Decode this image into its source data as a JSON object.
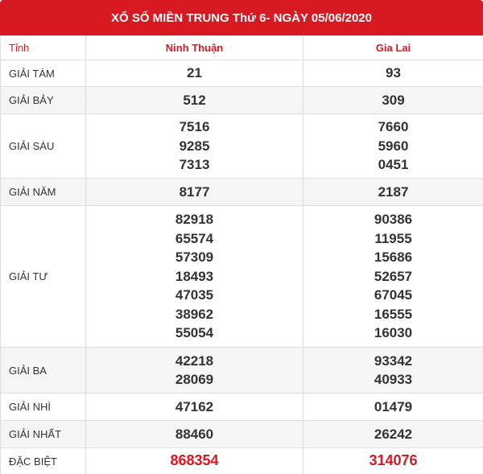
{
  "title": "XỔ SỐ MIỀN TRUNG Thứ 6- NGÀY 05/06/2020",
  "header": {
    "col_label": "Tỉnh",
    "provinces": [
      "Ninh Thuận",
      "Gia Lai"
    ]
  },
  "rows": [
    {
      "label": "GIẢI TÁM",
      "values": [
        [
          "21"
        ],
        [
          "93"
        ]
      ]
    },
    {
      "label": "GIẢI BẢY",
      "values": [
        [
          "512"
        ],
        [
          "309"
        ]
      ]
    },
    {
      "label": "GIẢI SÁU",
      "values": [
        [
          "7516",
          "9285",
          "7313"
        ],
        [
          "7660",
          "5960",
          "0451"
        ]
      ]
    },
    {
      "label": "GIẢI NĂM",
      "values": [
        [
          "8177"
        ],
        [
          "2187"
        ]
      ]
    },
    {
      "label": "GIẢI TƯ",
      "values": [
        [
          "82918",
          "65574",
          "57309",
          "18493",
          "47035",
          "38962",
          "55054"
        ],
        [
          "90386",
          "11955",
          "15686",
          "52657",
          "67045",
          "16555",
          "16030"
        ]
      ]
    },
    {
      "label": "GIẢI BA",
      "values": [
        [
          "42218",
          "28069"
        ],
        [
          "93342",
          "40933"
        ]
      ]
    },
    {
      "label": "GIẢI NHÌ",
      "values": [
        [
          "47162"
        ],
        [
          "01479"
        ]
      ]
    },
    {
      "label": "GIẢI NHẤT",
      "values": [
        [
          "88460"
        ],
        [
          "26242"
        ]
      ]
    },
    {
      "label": "ĐẶC BIỆT",
      "values": [
        [
          "868354"
        ],
        [
          "314076"
        ]
      ]
    }
  ],
  "colors": {
    "accent": "#d71921",
    "border": "#dddddd",
    "alt_row": "#f5f5f5",
    "text": "#333333"
  }
}
